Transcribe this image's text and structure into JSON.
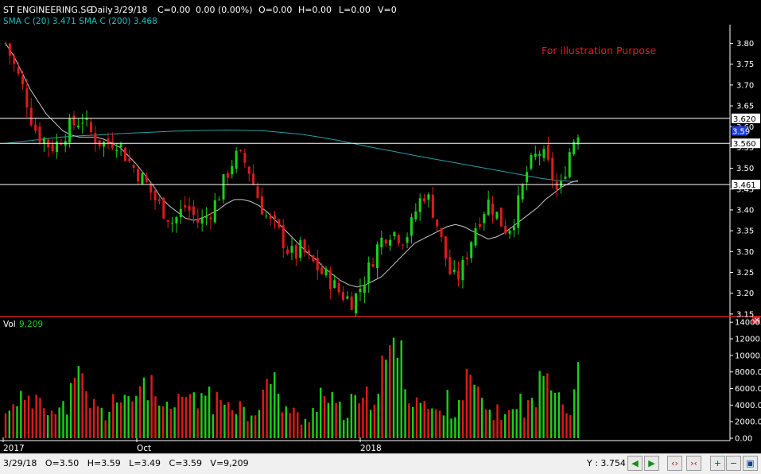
{
  "header": {
    "symbol": "ST ENGINEERING.SG",
    "period": "-Daily",
    "date": "3/29/18",
    "change": "C=0.00",
    "change_pct": "0.00 (0.00%)",
    "open": "O=0.00",
    "high": "H=0.00",
    "low": "L=0.00",
    "volume": "V=0",
    "sma_line": "SMA C (20) 3.471 SMA C (200) 3.468"
  },
  "annotation": "For illustration Purpose",
  "volume_panel": {
    "label": "Vol",
    "value": "9,209"
  },
  "status": {
    "ohlc_text": "3/29/18   O=3.50   H=3.59   L=3.49   C=3.59   V=9,209",
    "y_readout": "Y : 3.754"
  },
  "colors": {
    "background": "#000000",
    "up": "#19d219",
    "down": "#e01a1a",
    "sma20": "#c8c8c8",
    "sma200": "#2a9fa8",
    "last_price_marker": "#1d3fd6"
  },
  "chart_data": [
    {
      "type": "candlestick",
      "x_tick_labels": [
        "2017",
        "Oct",
        "2018"
      ],
      "y_ticks": [
        "3.80",
        "3.75",
        "3.70",
        "3.65",
        "3.60",
        "3.55",
        "3.50",
        "3.45",
        "3.40",
        "3.35",
        "3.30",
        "3.25",
        "3.20",
        "3.15"
      ],
      "ylim": [
        3.144,
        3.845
      ],
      "grid": false,
      "horizontal_levels": [
        {
          "value": 3.62,
          "label": "3.620"
        },
        {
          "value": 3.56,
          "label": "3.560"
        },
        {
          "value": 3.461,
          "label": "3.461"
        }
      ],
      "last_price": {
        "value": 3.59,
        "label": "3.59"
      },
      "close_path": [
        3.8,
        3.76,
        3.72,
        3.68,
        3.62,
        3.58,
        3.57,
        3.55,
        3.56,
        3.58,
        3.6,
        3.61,
        3.62,
        3.59,
        3.57,
        3.56,
        3.56,
        3.57,
        3.55,
        3.52,
        3.5,
        3.48,
        3.46,
        3.43,
        3.41,
        3.39,
        3.37,
        3.39,
        3.41,
        3.39,
        3.37,
        3.38,
        3.4,
        3.43,
        3.47,
        3.51,
        3.53,
        3.52,
        3.49,
        3.44,
        3.4,
        3.37,
        3.36,
        3.33,
        3.3,
        3.29,
        3.31,
        3.28,
        3.27,
        3.25,
        3.24,
        3.22,
        3.2,
        3.19,
        3.18,
        3.21,
        3.24,
        3.28,
        3.32,
        3.34,
        3.35,
        3.34,
        3.33,
        3.36,
        3.41,
        3.44,
        3.42,
        3.37,
        3.31,
        3.25,
        3.23,
        3.26,
        3.31,
        3.36,
        3.39,
        3.42,
        3.4,
        3.37,
        3.35,
        3.38,
        3.43,
        3.49,
        3.52,
        3.54,
        3.52,
        3.48,
        3.43,
        3.5,
        3.56,
        3.59
      ],
      "sma20": [
        3.8,
        3.77,
        3.73,
        3.69,
        3.66,
        3.63,
        3.61,
        3.59,
        3.58,
        3.575,
        3.575,
        3.575,
        3.57,
        3.56,
        3.55,
        3.53,
        3.51,
        3.485,
        3.46,
        3.43,
        3.41,
        3.395,
        3.38,
        3.375,
        3.38,
        3.39,
        3.4,
        3.415,
        3.425,
        3.425,
        3.42,
        3.41,
        3.395,
        3.375,
        3.355,
        3.335,
        3.315,
        3.295,
        3.28,
        3.26,
        3.245,
        3.23,
        3.22,
        3.215,
        3.22,
        3.23,
        3.24,
        3.26,
        3.28,
        3.3,
        3.32,
        3.33,
        3.34,
        3.35,
        3.36,
        3.365,
        3.36,
        3.35,
        3.34,
        3.33,
        3.335,
        3.345,
        3.36,
        3.375,
        3.39,
        3.405,
        3.425,
        3.44,
        3.455,
        3.465,
        3.471
      ],
      "sma200": [
        3.56,
        3.565,
        3.57,
        3.575,
        3.578,
        3.58,
        3.583,
        3.585,
        3.587,
        3.589,
        3.59,
        3.591,
        3.592,
        3.591,
        3.59,
        3.586,
        3.582,
        3.575,
        3.567,
        3.558,
        3.549,
        3.541,
        3.532,
        3.524,
        3.516,
        3.508,
        3.5,
        3.492,
        3.484,
        3.476,
        3.47,
        3.468
      ],
      "series": [
        {
          "name": "SMA C (20)",
          "last_value": 3.471
        },
        {
          "name": "SMA C (200)",
          "last_value": 3.468
        }
      ]
    },
    {
      "type": "bar",
      "y_ticks": [
        "14000.00",
        "12000.00",
        "10000.00",
        "8000.00",
        "6000.00",
        "4000.00",
        "2000.00",
        "0.00"
      ],
      "ylim": [
        0,
        14500
      ],
      "last_value": 9209,
      "value_path": [
        3,
        6,
        5,
        4,
        7,
        5,
        3,
        4,
        6,
        8,
        5,
        4,
        3,
        6,
        4,
        5,
        7,
        8,
        5,
        4,
        3,
        5,
        6,
        4,
        7,
        5,
        4,
        6,
        5,
        3,
        4,
        6,
        8,
        5,
        4,
        3,
        2,
        4,
        6,
        5,
        4,
        3,
        5,
        4,
        6,
        8,
        9,
        14,
        8,
        6,
        5,
        4,
        3,
        5,
        4,
        6,
        8,
        5,
        4,
        3,
        4,
        3,
        5,
        4,
        6,
        8,
        11,
        5,
        4,
        9
      ]
    }
  ]
}
